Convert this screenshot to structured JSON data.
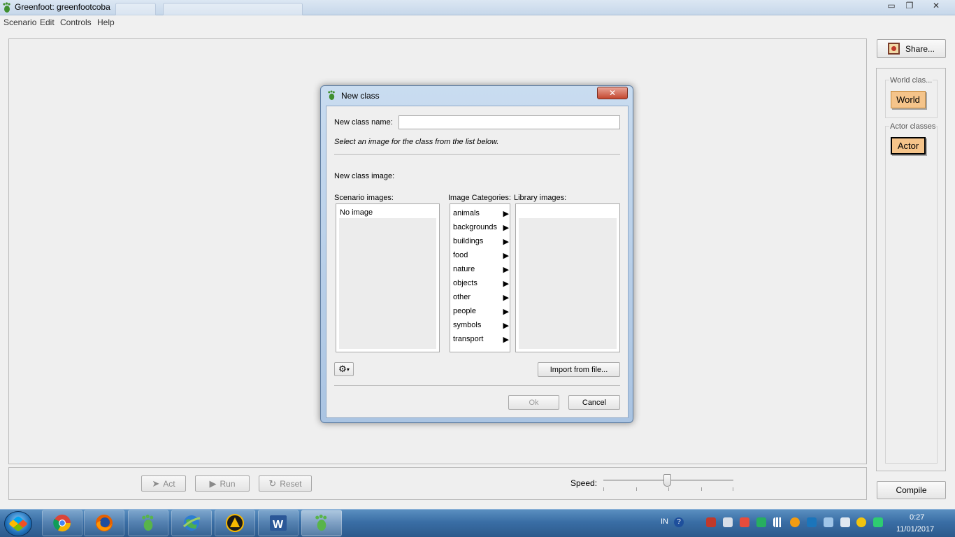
{
  "window": {
    "title": "Greenfoot: greenfootcoba",
    "controls": {
      "minimize": "▭",
      "restore": "❐",
      "close": "✕"
    }
  },
  "menu": [
    "Scenario",
    "Edit",
    "Controls",
    "Help"
  ],
  "toolbar": {
    "act_label": "Act",
    "run_label": "Run",
    "reset_label": "Reset",
    "speed_label": "Speed:",
    "speed_value": 0.49
  },
  "right_panel": {
    "share_label": "Share...",
    "world_group_title": "World clas...",
    "world_class": "World",
    "actor_group_title": "Actor classes",
    "actor_class": "Actor",
    "compile_label": "Compile"
  },
  "dialog": {
    "title": "New class",
    "close_label": "✕",
    "name_label": "New class name:",
    "name_value": "",
    "instruction": "Select an image for the class from the list below.",
    "image_label": "New class image:",
    "scenario_images_label": "Scenario images:",
    "scenario_images": [
      "No image"
    ],
    "categories_label": "Image Categories:",
    "categories": [
      "animals",
      "backgrounds",
      "buildings",
      "food",
      "nature",
      "objects",
      "other",
      "people",
      "symbols",
      "transport"
    ],
    "library_images_label": "Library images:",
    "import_label": "Import from file...",
    "ok_label": "Ok",
    "cancel_label": "Cancel"
  },
  "taskbar": {
    "language": "IN",
    "time": "0:27",
    "date": "11/01/2017"
  }
}
